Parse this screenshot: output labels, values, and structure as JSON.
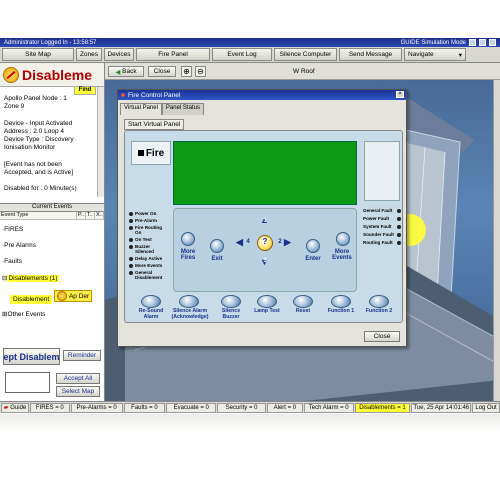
{
  "window": {
    "title_left": "Administrator Logged In - 13:58:57",
    "title_right": "GUIDE Simulation Mode"
  },
  "menu": {
    "site_map": "Site Map",
    "zones": "Zones",
    "devices": "Devices",
    "fire_panel": "Fire Panel",
    "event_log": "Event Log",
    "silence_computer": "Silence Computer",
    "send_message": "Send Message",
    "navigate": "Navigate"
  },
  "left": {
    "title": "Disableme",
    "find": "Find",
    "info_lines": [
      "Apollo Panel   Node : 1",
      "Zone 9",
      "",
      "Device - Input Activated",
      "Address : 2.0   Loop 4",
      "Device Type : Discovery",
      "Ionisation Monitor",
      "",
      "[Event has not been",
      "Accepted, and is Active]",
      "",
      "Disabled for : 0 Minute(s)"
    ],
    "current_events": "Current Events",
    "col_event_type": "Event Type",
    "col_p": "P..",
    "col_t": "T..",
    "col_x": "X..",
    "tree": {
      "fires": "FIRES",
      "pre_alarms": "Pre Alarms",
      "faults": "Faults",
      "disablements": "Disablements (1)",
      "disablement": "Disablement",
      "ap_det": "Ap Der",
      "other_events": "Other Events"
    },
    "accept_btn": "ept Disablem",
    "reminder": "Reminder",
    "accept_all": "Accept All",
    "select_map": "Select Map"
  },
  "map": {
    "back": "Back",
    "close": "Close",
    "title": "W Roof"
  },
  "dialog": {
    "title": "Fire Control Panel",
    "tab_virtual": "Virtual Panel",
    "tab_status": "Panel Status",
    "start_tab": "Start Virtual Panel",
    "fire": "Fire",
    "leds_left": [
      "Power On",
      "Pre-Alarm",
      "Fire Routing On",
      "On Test",
      "Buzzer Silenced",
      "Delay Active",
      "More Events",
      "General Disablement"
    ],
    "leds_right": [
      "General Fault",
      "Power Fault",
      "System Fault",
      "Sounder Fault",
      "Routing Fault"
    ],
    "keys": {
      "more_fires": "More Fires",
      "exit": "Exit",
      "enter": "Enter",
      "more_events": "More Events",
      "k1": "1",
      "k2": "2",
      "k3": "3",
      "k4": "4",
      "help": "?"
    },
    "functions": [
      "Re-Sound Alarm",
      "Silence Alarm (Acknowledge)",
      "Silence Buzzer",
      "Lamp Test",
      "Reset",
      "Function 1",
      "Function 2"
    ],
    "close": "Close"
  },
  "status": {
    "guide": "Guide",
    "fires": "FIRES = 0",
    "pre_alarms": "Pre-Alarms = 0",
    "faults": "Faults = 0",
    "evacuate": "Evacuate = 0",
    "security": "Security = 0",
    "alert": "Alert = 0",
    "tech_alarm": "Tech Alarm = 0",
    "disablements": "Disablements = 1",
    "datetime": "Tue, 25 Apr  14:01:46",
    "log_out": "Log Out"
  },
  "colors": {
    "title_bar": "#2c48b5",
    "lcd": "#0c9a12",
    "highlight": "#ffff33",
    "disable_red": "#b00000"
  }
}
